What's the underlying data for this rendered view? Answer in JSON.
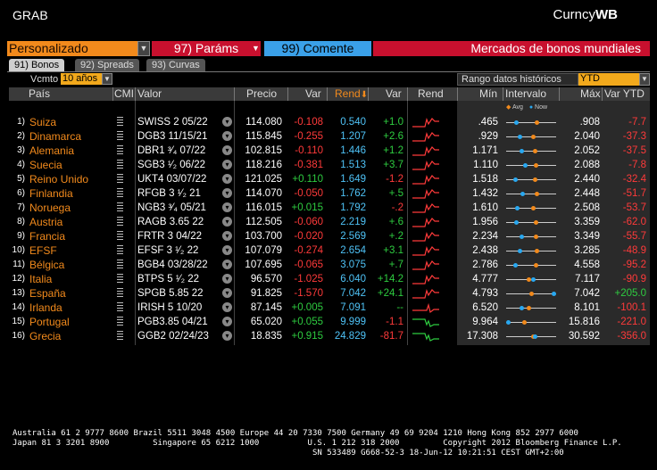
{
  "window": {
    "title": "GRAB",
    "crncy_prefix": "Curncy",
    "crncy_suffix": "WB"
  },
  "toolbar": {
    "combo_value": "Personalizado",
    "params_label": "97) Paráms",
    "comment_label": "99)  Comente",
    "header_title": "Mercados de bonos mundiales"
  },
  "tabs": [
    {
      "label": "91) Bonos",
      "active": true
    },
    {
      "label": "92) Spreads",
      "active": false
    },
    {
      "label": "93) Curvas",
      "active": false
    }
  ],
  "filters": {
    "vcmto_label": "Vcmto",
    "vcmto_value": "10 años",
    "range_label": "Rango datos históricos",
    "range_value": "YTD"
  },
  "columns": {
    "pais": "País",
    "cmi": "CMI",
    "valor": "Valor",
    "precio": "Precio",
    "var1": "Var",
    "rend": "Rend",
    "var2": "Var",
    "rend2": "Rend",
    "min": "Mín",
    "intervalo": "Intervalo",
    "max": "Máx",
    "varytd": "Var YTD"
  },
  "legend": {
    "avg": "Avg",
    "now": "Now"
  },
  "colors": {
    "orange": "#f28a1c",
    "red": "#c8102e",
    "blue": "#3aa0e8",
    "green": "#2ecc40",
    "neg": "#ff3a3a",
    "cyan": "#4fc3f7"
  },
  "rows": [
    {
      "idx": "1)",
      "country": "Suiza",
      "bond": "SWISS 2 05/22",
      "price": "114.080",
      "pvar": "-0.108",
      "yield": "0.540",
      "yvar": "+1.0",
      "min": ".465",
      "max": ".908",
      "ytd": "-7.7",
      "avg": 0.62,
      "now": 0.18,
      "spark": "up"
    },
    {
      "idx": "2)",
      "country": "Dinamarca",
      "bond": "DGB3 11/15/21",
      "price": "115.845",
      "pvar": "-0.255",
      "yield": "1.207",
      "yvar": "+2.6",
      "min": ".929",
      "max": "2.040",
      "ytd": "-37.3",
      "avg": 0.55,
      "now": 0.25,
      "spark": "up"
    },
    {
      "idx": "3)",
      "country": "Alemania",
      "bond": "DBR1 ³⁄₄ 07/22",
      "price": "102.815",
      "pvar": "-0.110",
      "yield": "1.446",
      "yvar": "+1.2",
      "min": "1.171",
      "max": "2.052",
      "ytd": "-37.5",
      "avg": 0.58,
      "now": 0.3,
      "spark": "up"
    },
    {
      "idx": "4)",
      "country": "Suecia",
      "bond": "SGB3 ¹⁄₂ 06/22",
      "price": "118.216",
      "pvar": "-0.381",
      "yield": "1.513",
      "yvar": "+3.7",
      "min": "1.110",
      "max": "2.088",
      "ytd": "-7.8",
      "avg": 0.6,
      "now": 0.38,
      "spark": "up"
    },
    {
      "idx": "5)",
      "country": "Reino Unido",
      "bond": "UKT4 03/07/22",
      "price": "121.025",
      "pvar": "+0.110",
      "yield": "1.649",
      "yvar": "-1.2",
      "min": "1.518",
      "max": "2.440",
      "ytd": "-32.4",
      "avg": 0.58,
      "now": 0.15,
      "spark": "up"
    },
    {
      "idx": "6)",
      "country": "Finlandia",
      "bond": "RFGB 3 ¹⁄₂ 21",
      "price": "114.070",
      "pvar": "-0.050",
      "yield": "1.762",
      "yvar": "+.5",
      "min": "1.432",
      "max": "2.448",
      "ytd": "-51.7",
      "avg": 0.62,
      "now": 0.32,
      "spark": "up"
    },
    {
      "idx": "7)",
      "country": "Noruega",
      "bond": "NGB3 ³⁄₄ 05/21",
      "price": "116.015",
      "pvar": "+0.015",
      "yield": "1.792",
      "yvar": "-.2",
      "min": "1.610",
      "max": "2.508",
      "ytd": "-53.7",
      "avg": 0.55,
      "now": 0.2,
      "spark": "up"
    },
    {
      "idx": "8)",
      "country": "Austria",
      "bond": "RAGB 3.65 22",
      "price": "112.505",
      "pvar": "-0.060",
      "yield": "2.219",
      "yvar": "+.6",
      "min": "1.956",
      "max": "3.359",
      "ytd": "-62.0",
      "avg": 0.6,
      "now": 0.18,
      "spark": "up"
    },
    {
      "idx": "9)",
      "country": "Francia",
      "bond": "FRTR 3 04/22",
      "price": "103.700",
      "pvar": "-0.020",
      "yield": "2.569",
      "yvar": "+.2",
      "min": "2.234",
      "max": "3.349",
      "ytd": "-55.7",
      "avg": 0.6,
      "now": 0.3,
      "spark": "up"
    },
    {
      "idx": "10)",
      "country": "EFSF",
      "bond": "EFSF 3 ¹⁄₂ 22",
      "price": "107.079",
      "pvar": "-0.274",
      "yield": "2.654",
      "yvar": "+3.1",
      "min": "2.438",
      "max": "3.285",
      "ytd": "-48.9",
      "avg": 0.62,
      "now": 0.25,
      "spark": "up"
    },
    {
      "idx": "11)",
      "country": "Bélgica",
      "bond": "BGB4 03/28/22",
      "price": "107.695",
      "pvar": "-0.065",
      "yield": "3.075",
      "yvar": "+.7",
      "min": "2.786",
      "max": "4.558",
      "ytd": "-95.2",
      "avg": 0.6,
      "now": 0.15,
      "spark": "up"
    },
    {
      "idx": "12)",
      "country": "Italia",
      "bond": "BTPS 5 ¹⁄₂ 22",
      "price": "96.570",
      "pvar": "-1.025",
      "yield": "6.040",
      "yvar": "+14.2",
      "min": "4.777",
      "max": "7.117",
      "ytd": "-90.9",
      "avg": 0.45,
      "now": 0.55,
      "spark": "up"
    },
    {
      "idx": "13)",
      "country": "España",
      "bond": "SPGB 5.85 22",
      "price": "91.825",
      "pvar": "-1.570",
      "yield": "7.042",
      "yvar": "+24.1",
      "min": "4.793",
      "max": "7.042",
      "ytd": "+205.0",
      "avg": 0.5,
      "now": 1.0,
      "spark": "up"
    },
    {
      "idx": "14)",
      "country": "Irlanda",
      "bond": "IRISH 5 10/20",
      "price": "87.145",
      "pvar": "+0.005",
      "yield": "7.091",
      "yvar": "--",
      "min": "6.520",
      "max": "8.101",
      "ytd": "-100.1",
      "avg": 0.45,
      "now": 0.3,
      "spark": "flat"
    },
    {
      "idx": "15)",
      "country": "Portugal",
      "bond": "PGB3.85 04/21",
      "price": "65.020",
      "pvar": "+0.055",
      "yield": "9.999",
      "yvar": "-1.1",
      "min": "9.964",
      "max": "15.816",
      "ytd": "-221.0",
      "avg": 0.35,
      "now": 0.0,
      "spark": "down"
    },
    {
      "idx": "16)",
      "country": "Grecia",
      "bond": "GGB2 02/24/23",
      "price": "18.835",
      "pvar": "+0.915",
      "yield": "24.829",
      "yvar": "-81.7",
      "min": "17.308",
      "max": "30.592",
      "ytd": "-356.0",
      "avg": 0.55,
      "now": 0.58,
      "spark": "down"
    }
  ],
  "footer": {
    "line1": "Australia 61 2 9777 8600 Brazil 5511 3048 4500 Europe 44 20 7330 7500 Germany 49 69 9204 1210 Hong Kong 852 2977 6000",
    "line2": "Japan 81 3 3201 8900         Singapore 65 6212 1000          U.S. 1 212 318 2000         Copyright 2012 Bloomberg Finance L.P.",
    "line3": "                                                              SN 533489 G668-52-3 18-Jun-12 10:21:51 CEST GMT+2:00"
  }
}
